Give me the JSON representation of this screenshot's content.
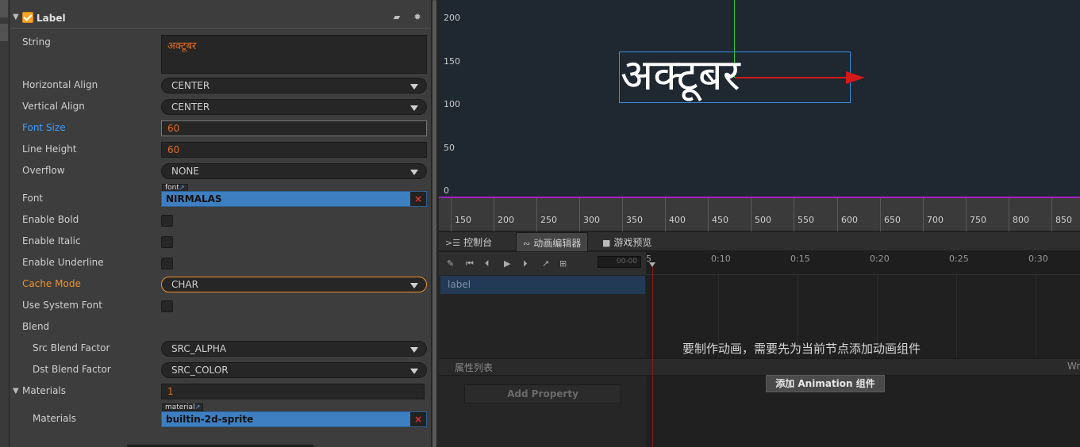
{
  "inspector": {
    "component_title": "Label",
    "props": {
      "string_label": "String",
      "string_value": "अक्टूबर",
      "halign_label": "Horizontal Align",
      "halign_value": "CENTER",
      "valign_label": "Vertical Align",
      "valign_value": "CENTER",
      "font_size_label": "Font Size",
      "font_size_value": "60",
      "line_height_label": "Line Height",
      "line_height_value": "60",
      "overflow_label": "Overflow",
      "overflow_value": "NONE",
      "font_label": "Font",
      "font_tag": "font",
      "font_value": "NIRMALAS",
      "bold_label": "Enable Bold",
      "italic_label": "Enable Italic",
      "underline_label": "Enable Underline",
      "cache_label": "Cache Mode",
      "cache_value": "CHAR",
      "sysfont_label": "Use System Font",
      "blend_label": "Blend",
      "src_blend_label": "Src Blend Factor",
      "src_blend_value": "SRC_ALPHA",
      "dst_blend_label": "Dst Blend Factor",
      "dst_blend_value": "SRC_COLOR",
      "materials_label": "Materials",
      "materials_count": "1",
      "material_item_label": "Materials",
      "material_tag": "material",
      "material_value": "builtin-2d-sprite"
    },
    "icons": {
      "book": "book-icon",
      "gear": "gear-icon",
      "clear": "×"
    }
  },
  "scene": {
    "y_ticks": [
      "200",
      "150",
      "100",
      "50",
      "0"
    ],
    "x_ticks": [
      "150",
      "200",
      "250",
      "300",
      "350",
      "400",
      "450",
      "500",
      "550",
      "600",
      "650",
      "700",
      "750",
      "800",
      "850"
    ],
    "node_text": "अक्टूबर"
  },
  "panel": {
    "tabs": {
      "console": "控制台",
      "anim_editor": "动画编辑器",
      "preview": "游戏预览"
    },
    "time_display": "00-00",
    "timeline_labels": [
      "5",
      "0:10",
      "0:15",
      "0:20",
      "0:25",
      "0:30"
    ],
    "node_name": "label",
    "prop_list_label": "属性列表",
    "prop_list_right": "Wr",
    "add_property": "Add Property",
    "hint": "要制作动画，需要先为当前节点添加动画组件",
    "add_anim_button": "添加 Animation 组件"
  },
  "colors": {
    "accent_orange": "#f0912b",
    "label_blue": "#3b9cff",
    "asset_blue": "#3e7fc1",
    "node_blue": "#3a8fe0",
    "axis_red": "#d41919",
    "axis_green": "#33cc33"
  }
}
